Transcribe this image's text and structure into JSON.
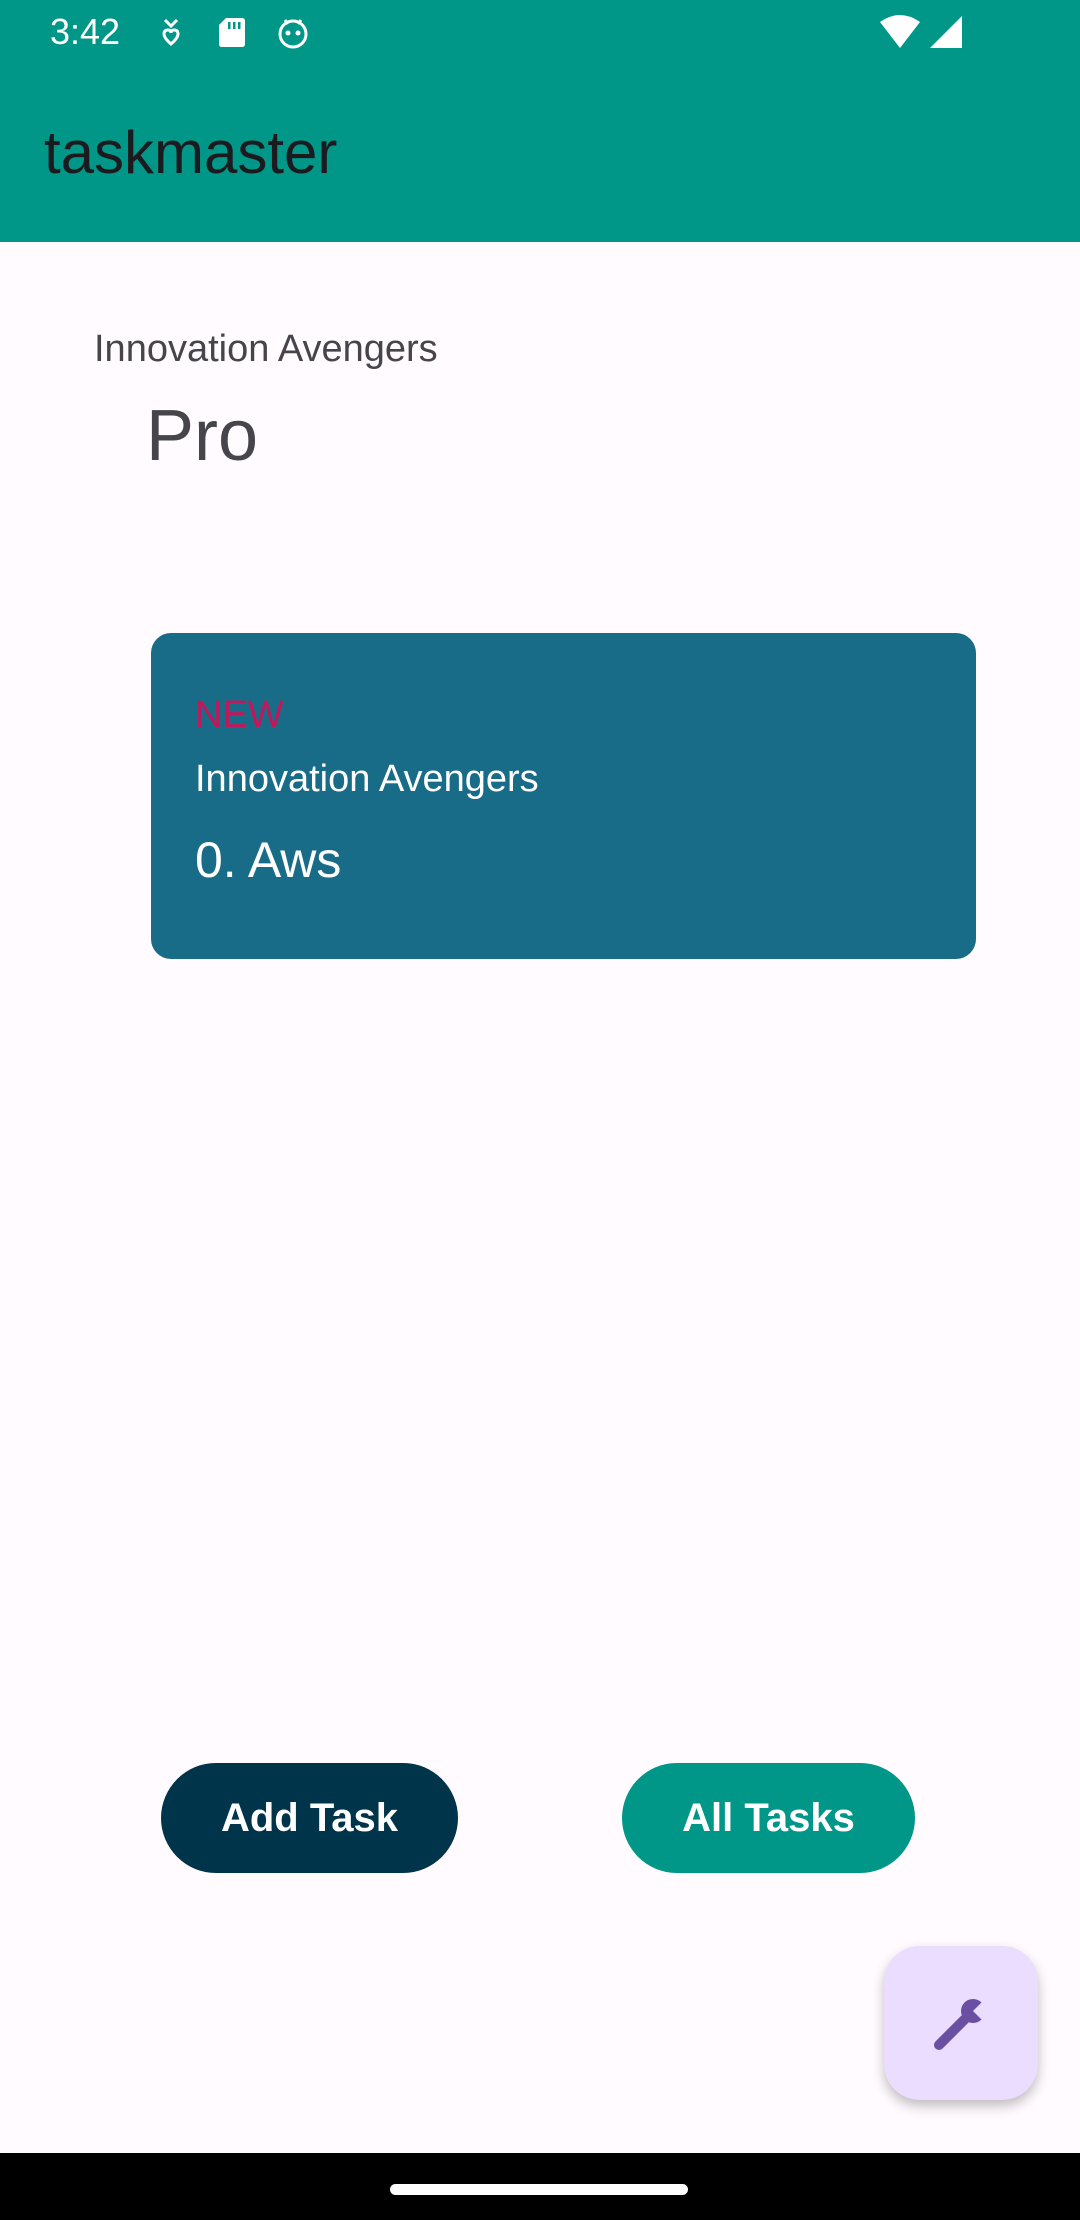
{
  "status_bar": {
    "time": "3:42",
    "icons": [
      "hearts-notification-icon",
      "sd-card-icon",
      "android-robot-icon",
      "wifi-icon",
      "cell-signal-icon"
    ]
  },
  "app_bar": {
    "title": "taskmaster",
    "color": "#009688"
  },
  "main": {
    "team_name": "Innovation Avengers",
    "plan": "Pro"
  },
  "task_card": {
    "status": "NEW",
    "team": "Innovation Avengers",
    "title": "0. Aws",
    "background": "#196C88",
    "status_color": "#C2185B"
  },
  "actions": {
    "add_task_label": "Add Task",
    "all_tasks_label": "All Tasks"
  },
  "fab": {
    "icon": "wrench-icon"
  }
}
